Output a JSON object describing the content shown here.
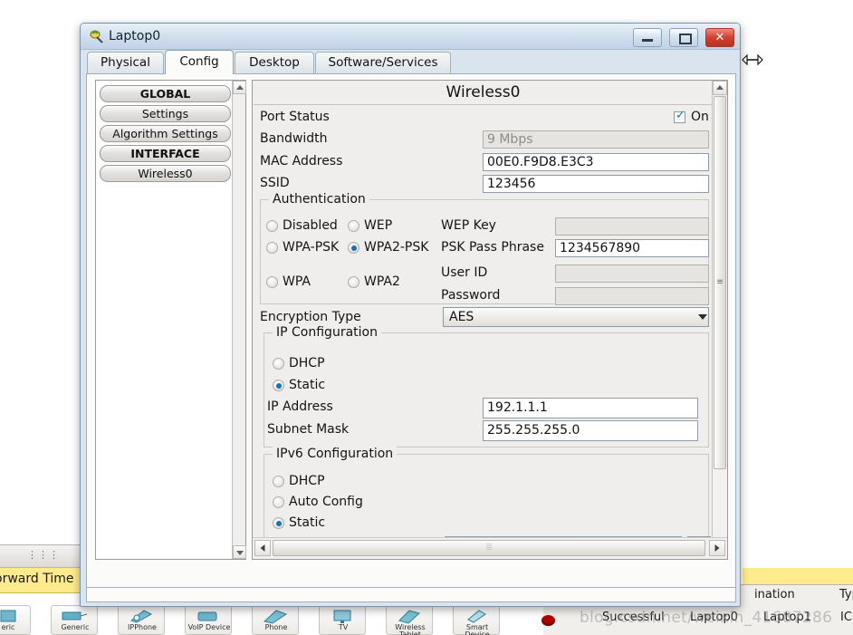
{
  "window": {
    "title": "Laptop0",
    "icon": "laptop-wireless-icon",
    "minimize_label": "Minimize",
    "maximize_label": "Maximize",
    "close_label": "Close"
  },
  "tabs": [
    {
      "label": "Physical",
      "active": false
    },
    {
      "label": "Config",
      "active": true
    },
    {
      "label": "Desktop",
      "active": false
    },
    {
      "label": "Software/Services",
      "active": false
    }
  ],
  "sidebar": {
    "items": [
      {
        "label": "GLOBAL",
        "bold": true
      },
      {
        "label": "Settings",
        "bold": false
      },
      {
        "label": "Algorithm Settings",
        "bold": false
      },
      {
        "label": "INTERFACE",
        "bold": true
      },
      {
        "label": "Wireless0",
        "bold": false
      }
    ]
  },
  "panel": {
    "title": "Wireless0",
    "port_status": {
      "label": "Port Status",
      "checkbox_label": "On",
      "checked": true
    },
    "bandwidth": {
      "label": "Bandwidth",
      "value": "9 Mbps",
      "disabled": true
    },
    "mac_address": {
      "label": "MAC Address",
      "value": "00E0.F9D8.E3C3"
    },
    "ssid": {
      "label": "SSID",
      "value": "123456"
    },
    "authentication": {
      "title": "Authentication",
      "options": [
        {
          "label": "Disabled",
          "selected": false
        },
        {
          "label": "WEP",
          "selected": false
        },
        {
          "label": "WPA-PSK",
          "selected": false
        },
        {
          "label": "WPA2-PSK",
          "selected": true
        },
        {
          "label": "WPA",
          "selected": false
        },
        {
          "label": "WPA2",
          "selected": false
        }
      ],
      "fields": [
        {
          "label": "WEP Key",
          "value": "",
          "disabled": true
        },
        {
          "label": "PSK Pass Phrase",
          "value": "1234567890",
          "disabled": false
        },
        {
          "label": "User ID",
          "value": "",
          "disabled": true
        },
        {
          "label": "Password",
          "value": "",
          "disabled": true
        }
      ]
    },
    "encryption": {
      "label": "Encryption Type",
      "value": "AES"
    },
    "ip_configuration": {
      "title": "IP Configuration",
      "options": [
        {
          "label": "DHCP",
          "selected": false
        },
        {
          "label": "Static",
          "selected": true
        }
      ],
      "ip_address": {
        "label": "IP Address",
        "value": "192.1.1.1"
      },
      "subnet_mask": {
        "label": "Subnet Mask",
        "value": "255.255.255.0"
      }
    },
    "ipv6_configuration": {
      "title": "IPv6 Configuration",
      "options": [
        {
          "label": "DHCP",
          "selected": false
        },
        {
          "label": "Auto Config",
          "selected": false
        },
        {
          "label": "Static",
          "selected": true
        }
      ]
    }
  },
  "background": {
    "forward_time_label": "orward Time",
    "sim_headers": {
      "destination": "ination",
      "type": "Type"
    },
    "sim_row": {
      "status": "Successful",
      "source": "Laptop0",
      "destination": "Laptop1",
      "type": "ICM"
    },
    "watermark": "blog.csdn.net/weixin_41687286",
    "palette": [
      {
        "label": "eric",
        "icon": "device-icon"
      },
      {
        "label": "Generic",
        "icon": "generic-device-icon"
      },
      {
        "label": "IPPhone",
        "icon": "ip-phone-icon"
      },
      {
        "label": "VoIP Device",
        "icon": "voip-device-icon"
      },
      {
        "label": "Phone",
        "icon": "phone-icon"
      },
      {
        "label": "TV",
        "icon": "tv-icon"
      },
      {
        "label": "Wireless Tablet",
        "icon": "wireless-tablet-icon"
      },
      {
        "label": "Smart Device",
        "icon": "smart-device-icon"
      }
    ]
  },
  "colors": {
    "accent": "#1275b0",
    "title_gradient_top": "#e9f1f8",
    "close_button": "#cf4030",
    "panel_bg": "#efeeec",
    "highlight_yellow": "#ffeb8e"
  }
}
